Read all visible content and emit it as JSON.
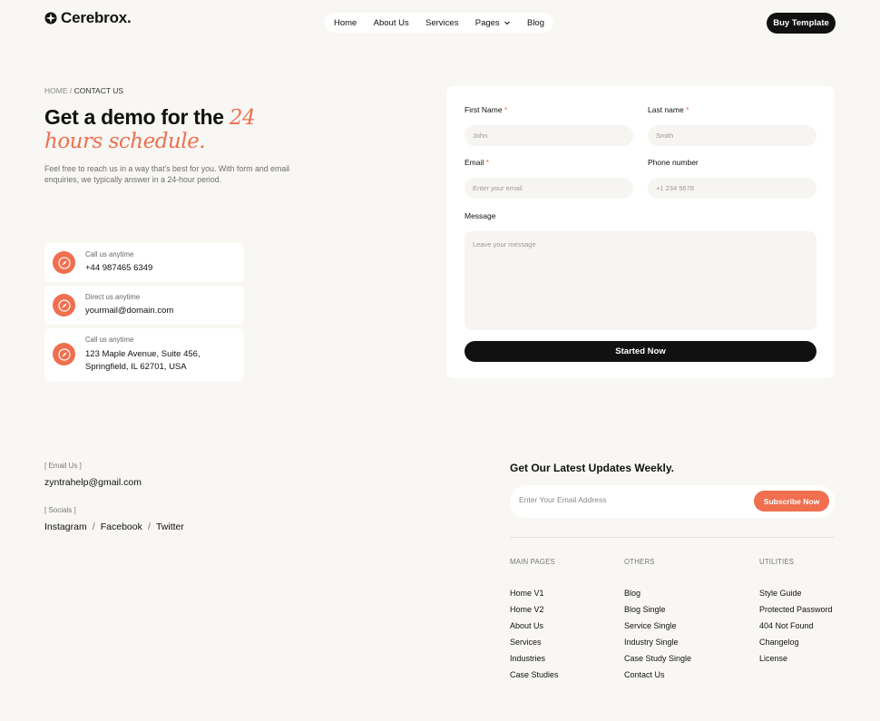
{
  "brand": {
    "name": "Cerebrox.",
    "accent_color": "#ef6f4f"
  },
  "nav": {
    "items": [
      "Home",
      "About Us",
      "Services",
      "Pages",
      "Blog"
    ],
    "buy_label": "Buy Template"
  },
  "hero": {
    "breadcrumb_home": "HOME",
    "breadcrumb_sep": " / ",
    "breadcrumb_current": "CONTACT US",
    "title_plain": "Get a demo for the ",
    "title_accent": "24 hours schedule.",
    "description": "Feel free to reach us in a way that's best for you. With form and email enquiries, we typically answer in a 24-hour period."
  },
  "contacts": [
    {
      "label": "Call us anytime",
      "value": "+44 987465 6349",
      "icon": "compass-icon"
    },
    {
      "label": "Direct us anytime",
      "value": "yourmail@domain.com",
      "icon": "compass-icon"
    },
    {
      "label": "Call us anytime",
      "value_line1": "123 Maple Avenue, Suite 456,",
      "value_line2": "Springfield, IL 62701, USA",
      "icon": "compass-icon"
    }
  ],
  "form": {
    "first_name_label": "First Name",
    "first_name_placeholder": "John",
    "last_name_label": "Last name",
    "last_name_placeholder": "Smith",
    "email_label": "Email",
    "email_placeholder": "Enter your email",
    "phone_label": "Phone number",
    "phone_placeholder": "+1 234 5678",
    "message_label": "Message",
    "message_placeholder": "Leave your message",
    "required_mark": "*",
    "submit_label": "Started Now"
  },
  "footer": {
    "email_heading": "[ Email Us ]",
    "email": "zyntrahelp@gmail.com",
    "socials_heading": "[ Socials ]",
    "socials": [
      "Instagram",
      "Facebook",
      "Twitter"
    ],
    "social_sep": "/",
    "newsletter_title": "Get Our Latest Updates Weekly.",
    "newsletter_placeholder": "Enter Your Email Address",
    "subscribe_label": "Subscribe Now",
    "columns": [
      {
        "heading": "MAIN PAGES",
        "links": [
          "Home V1",
          "Home V2",
          "About Us",
          "Services",
          "Industries",
          "Case Studies"
        ]
      },
      {
        "heading": "OTHERS",
        "links": [
          "Blog",
          "Blog Single",
          "Service Single",
          "Industry Single",
          "Case Study Single",
          "Contact Us"
        ]
      },
      {
        "heading": "UTILITIES",
        "links": [
          "Style Guide",
          "Protected Password",
          "404 Not Found",
          "Changelog",
          "License"
        ]
      }
    ]
  }
}
